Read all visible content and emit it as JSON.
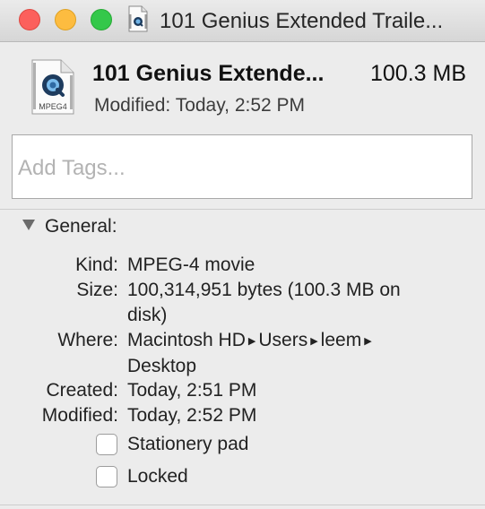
{
  "window": {
    "title": "101 Genius Extended Traile..."
  },
  "file": {
    "icon": "quicktime-mpeg4-file-icon",
    "icon_caption": "MPEG4",
    "name": "101 Genius Extende...",
    "size": "100.3 MB",
    "modified_label": "Modified:",
    "modified_value": "Today, 2:52 PM"
  },
  "tags": {
    "placeholder": "Add Tags..."
  },
  "general": {
    "title": "General:",
    "expanded": true,
    "kind_label": "Kind:",
    "kind_value": "MPEG-4 movie",
    "size_label": "Size:",
    "size_value_line1": "100,314,951 bytes (100.3 MB on",
    "size_value_line2": "disk)",
    "where_label": "Where:",
    "where_path": [
      "Macintosh HD",
      "Users",
      "leem"
    ],
    "where_line2": "Desktop",
    "created_label": "Created:",
    "created_value": "Today, 2:51 PM",
    "modified_label": "Modified:",
    "modified_value": "Today, 2:52 PM",
    "stationery_label": "Stationery pad",
    "stationery_checked": false,
    "locked_label": "Locked",
    "locked_checked": false
  },
  "colors": {
    "close": "#fc605c",
    "minimize": "#fdbc40",
    "zoom": "#34c84a",
    "background": "#ececec"
  }
}
